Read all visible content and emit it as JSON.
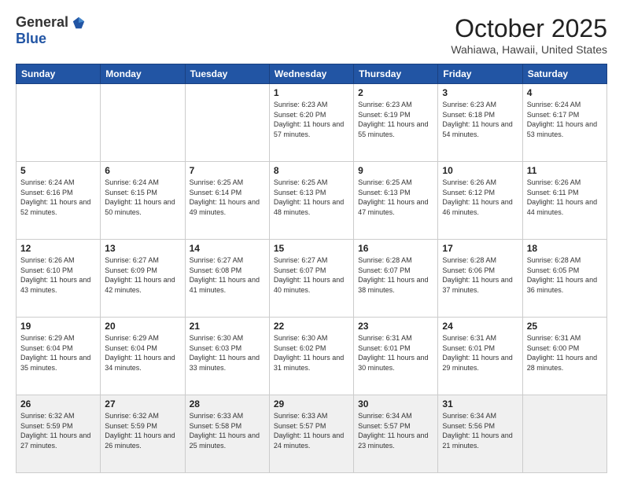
{
  "header": {
    "logo_general": "General",
    "logo_blue": "Blue",
    "month": "October 2025",
    "location": "Wahiawa, Hawaii, United States"
  },
  "weekdays": [
    "Sunday",
    "Monday",
    "Tuesday",
    "Wednesday",
    "Thursday",
    "Friday",
    "Saturday"
  ],
  "weeks": [
    [
      {
        "day": "",
        "sunrise": "",
        "sunset": "",
        "daylight": ""
      },
      {
        "day": "",
        "sunrise": "",
        "sunset": "",
        "daylight": ""
      },
      {
        "day": "",
        "sunrise": "",
        "sunset": "",
        "daylight": ""
      },
      {
        "day": "1",
        "sunrise": "Sunrise: 6:23 AM",
        "sunset": "Sunset: 6:20 PM",
        "daylight": "Daylight: 11 hours and 57 minutes."
      },
      {
        "day": "2",
        "sunrise": "Sunrise: 6:23 AM",
        "sunset": "Sunset: 6:19 PM",
        "daylight": "Daylight: 11 hours and 55 minutes."
      },
      {
        "day": "3",
        "sunrise": "Sunrise: 6:23 AM",
        "sunset": "Sunset: 6:18 PM",
        "daylight": "Daylight: 11 hours and 54 minutes."
      },
      {
        "day": "4",
        "sunrise": "Sunrise: 6:24 AM",
        "sunset": "Sunset: 6:17 PM",
        "daylight": "Daylight: 11 hours and 53 minutes."
      }
    ],
    [
      {
        "day": "5",
        "sunrise": "Sunrise: 6:24 AM",
        "sunset": "Sunset: 6:16 PM",
        "daylight": "Daylight: 11 hours and 52 minutes."
      },
      {
        "day": "6",
        "sunrise": "Sunrise: 6:24 AM",
        "sunset": "Sunset: 6:15 PM",
        "daylight": "Daylight: 11 hours and 50 minutes."
      },
      {
        "day": "7",
        "sunrise": "Sunrise: 6:25 AM",
        "sunset": "Sunset: 6:14 PM",
        "daylight": "Daylight: 11 hours and 49 minutes."
      },
      {
        "day": "8",
        "sunrise": "Sunrise: 6:25 AM",
        "sunset": "Sunset: 6:13 PM",
        "daylight": "Daylight: 11 hours and 48 minutes."
      },
      {
        "day": "9",
        "sunrise": "Sunrise: 6:25 AM",
        "sunset": "Sunset: 6:13 PM",
        "daylight": "Daylight: 11 hours and 47 minutes."
      },
      {
        "day": "10",
        "sunrise": "Sunrise: 6:26 AM",
        "sunset": "Sunset: 6:12 PM",
        "daylight": "Daylight: 11 hours and 46 minutes."
      },
      {
        "day": "11",
        "sunrise": "Sunrise: 6:26 AM",
        "sunset": "Sunset: 6:11 PM",
        "daylight": "Daylight: 11 hours and 44 minutes."
      }
    ],
    [
      {
        "day": "12",
        "sunrise": "Sunrise: 6:26 AM",
        "sunset": "Sunset: 6:10 PM",
        "daylight": "Daylight: 11 hours and 43 minutes."
      },
      {
        "day": "13",
        "sunrise": "Sunrise: 6:27 AM",
        "sunset": "Sunset: 6:09 PM",
        "daylight": "Daylight: 11 hours and 42 minutes."
      },
      {
        "day": "14",
        "sunrise": "Sunrise: 6:27 AM",
        "sunset": "Sunset: 6:08 PM",
        "daylight": "Daylight: 11 hours and 41 minutes."
      },
      {
        "day": "15",
        "sunrise": "Sunrise: 6:27 AM",
        "sunset": "Sunset: 6:07 PM",
        "daylight": "Daylight: 11 hours and 40 minutes."
      },
      {
        "day": "16",
        "sunrise": "Sunrise: 6:28 AM",
        "sunset": "Sunset: 6:07 PM",
        "daylight": "Daylight: 11 hours and 38 minutes."
      },
      {
        "day": "17",
        "sunrise": "Sunrise: 6:28 AM",
        "sunset": "Sunset: 6:06 PM",
        "daylight": "Daylight: 11 hours and 37 minutes."
      },
      {
        "day": "18",
        "sunrise": "Sunrise: 6:28 AM",
        "sunset": "Sunset: 6:05 PM",
        "daylight": "Daylight: 11 hours and 36 minutes."
      }
    ],
    [
      {
        "day": "19",
        "sunrise": "Sunrise: 6:29 AM",
        "sunset": "Sunset: 6:04 PM",
        "daylight": "Daylight: 11 hours and 35 minutes."
      },
      {
        "day": "20",
        "sunrise": "Sunrise: 6:29 AM",
        "sunset": "Sunset: 6:04 PM",
        "daylight": "Daylight: 11 hours and 34 minutes."
      },
      {
        "day": "21",
        "sunrise": "Sunrise: 6:30 AM",
        "sunset": "Sunset: 6:03 PM",
        "daylight": "Daylight: 11 hours and 33 minutes."
      },
      {
        "day": "22",
        "sunrise": "Sunrise: 6:30 AM",
        "sunset": "Sunset: 6:02 PM",
        "daylight": "Daylight: 11 hours and 31 minutes."
      },
      {
        "day": "23",
        "sunrise": "Sunrise: 6:31 AM",
        "sunset": "Sunset: 6:01 PM",
        "daylight": "Daylight: 11 hours and 30 minutes."
      },
      {
        "day": "24",
        "sunrise": "Sunrise: 6:31 AM",
        "sunset": "Sunset: 6:01 PM",
        "daylight": "Daylight: 11 hours and 29 minutes."
      },
      {
        "day": "25",
        "sunrise": "Sunrise: 6:31 AM",
        "sunset": "Sunset: 6:00 PM",
        "daylight": "Daylight: 11 hours and 28 minutes."
      }
    ],
    [
      {
        "day": "26",
        "sunrise": "Sunrise: 6:32 AM",
        "sunset": "Sunset: 5:59 PM",
        "daylight": "Daylight: 11 hours and 27 minutes."
      },
      {
        "day": "27",
        "sunrise": "Sunrise: 6:32 AM",
        "sunset": "Sunset: 5:59 PM",
        "daylight": "Daylight: 11 hours and 26 minutes."
      },
      {
        "day": "28",
        "sunrise": "Sunrise: 6:33 AM",
        "sunset": "Sunset: 5:58 PM",
        "daylight": "Daylight: 11 hours and 25 minutes."
      },
      {
        "day": "29",
        "sunrise": "Sunrise: 6:33 AM",
        "sunset": "Sunset: 5:57 PM",
        "daylight": "Daylight: 11 hours and 24 minutes."
      },
      {
        "day": "30",
        "sunrise": "Sunrise: 6:34 AM",
        "sunset": "Sunset: 5:57 PM",
        "daylight": "Daylight: 11 hours and 23 minutes."
      },
      {
        "day": "31",
        "sunrise": "Sunrise: 6:34 AM",
        "sunset": "Sunset: 5:56 PM",
        "daylight": "Daylight: 11 hours and 21 minutes."
      },
      {
        "day": "",
        "sunrise": "",
        "sunset": "",
        "daylight": ""
      }
    ]
  ]
}
